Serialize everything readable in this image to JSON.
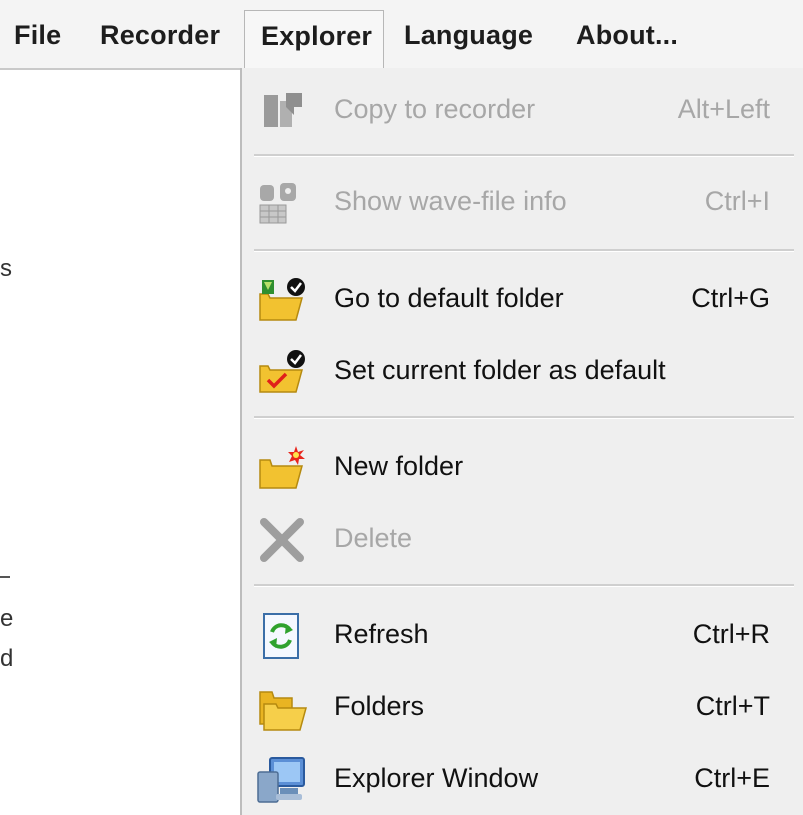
{
  "menubar": {
    "items": [
      {
        "label": "File"
      },
      {
        "label": "Recorder"
      },
      {
        "label": "Explorer"
      },
      {
        "label": "Language"
      },
      {
        "label": "About..."
      }
    ]
  },
  "background_fragments": [
    "s",
    "e",
    "d"
  ],
  "explorer_menu": {
    "items": [
      {
        "label": "Copy to recorder",
        "shortcut": "Alt+Left",
        "enabled": false,
        "icon": "copy-to-recorder-icon"
      },
      {
        "label": "Show wave-file info",
        "shortcut": "Ctrl+I",
        "enabled": false,
        "icon": "wave-file-info-icon"
      },
      {
        "label": "Go to default folder",
        "shortcut": "Ctrl+G",
        "enabled": true,
        "icon": "default-folder-icon"
      },
      {
        "label": "Set current folder as default",
        "shortcut": "",
        "enabled": true,
        "icon": "set-default-folder-icon"
      },
      {
        "label": "New folder",
        "shortcut": "",
        "enabled": true,
        "icon": "new-folder-icon"
      },
      {
        "label": "Delete",
        "shortcut": "",
        "enabled": false,
        "icon": "delete-icon"
      },
      {
        "label": "Refresh",
        "shortcut": "Ctrl+R",
        "enabled": true,
        "icon": "refresh-icon"
      },
      {
        "label": "Folders",
        "shortcut": "Ctrl+T",
        "enabled": true,
        "icon": "folders-icon"
      },
      {
        "label": "Explorer Window",
        "shortcut": "Ctrl+E",
        "enabled": true,
        "icon": "explorer-window-icon"
      }
    ]
  },
  "colors": {
    "menu_background": "#efefef",
    "disabled_text": "#a7a7a7",
    "folder_yellow": "#f2c230",
    "refresh_green": "#2fa22f"
  }
}
